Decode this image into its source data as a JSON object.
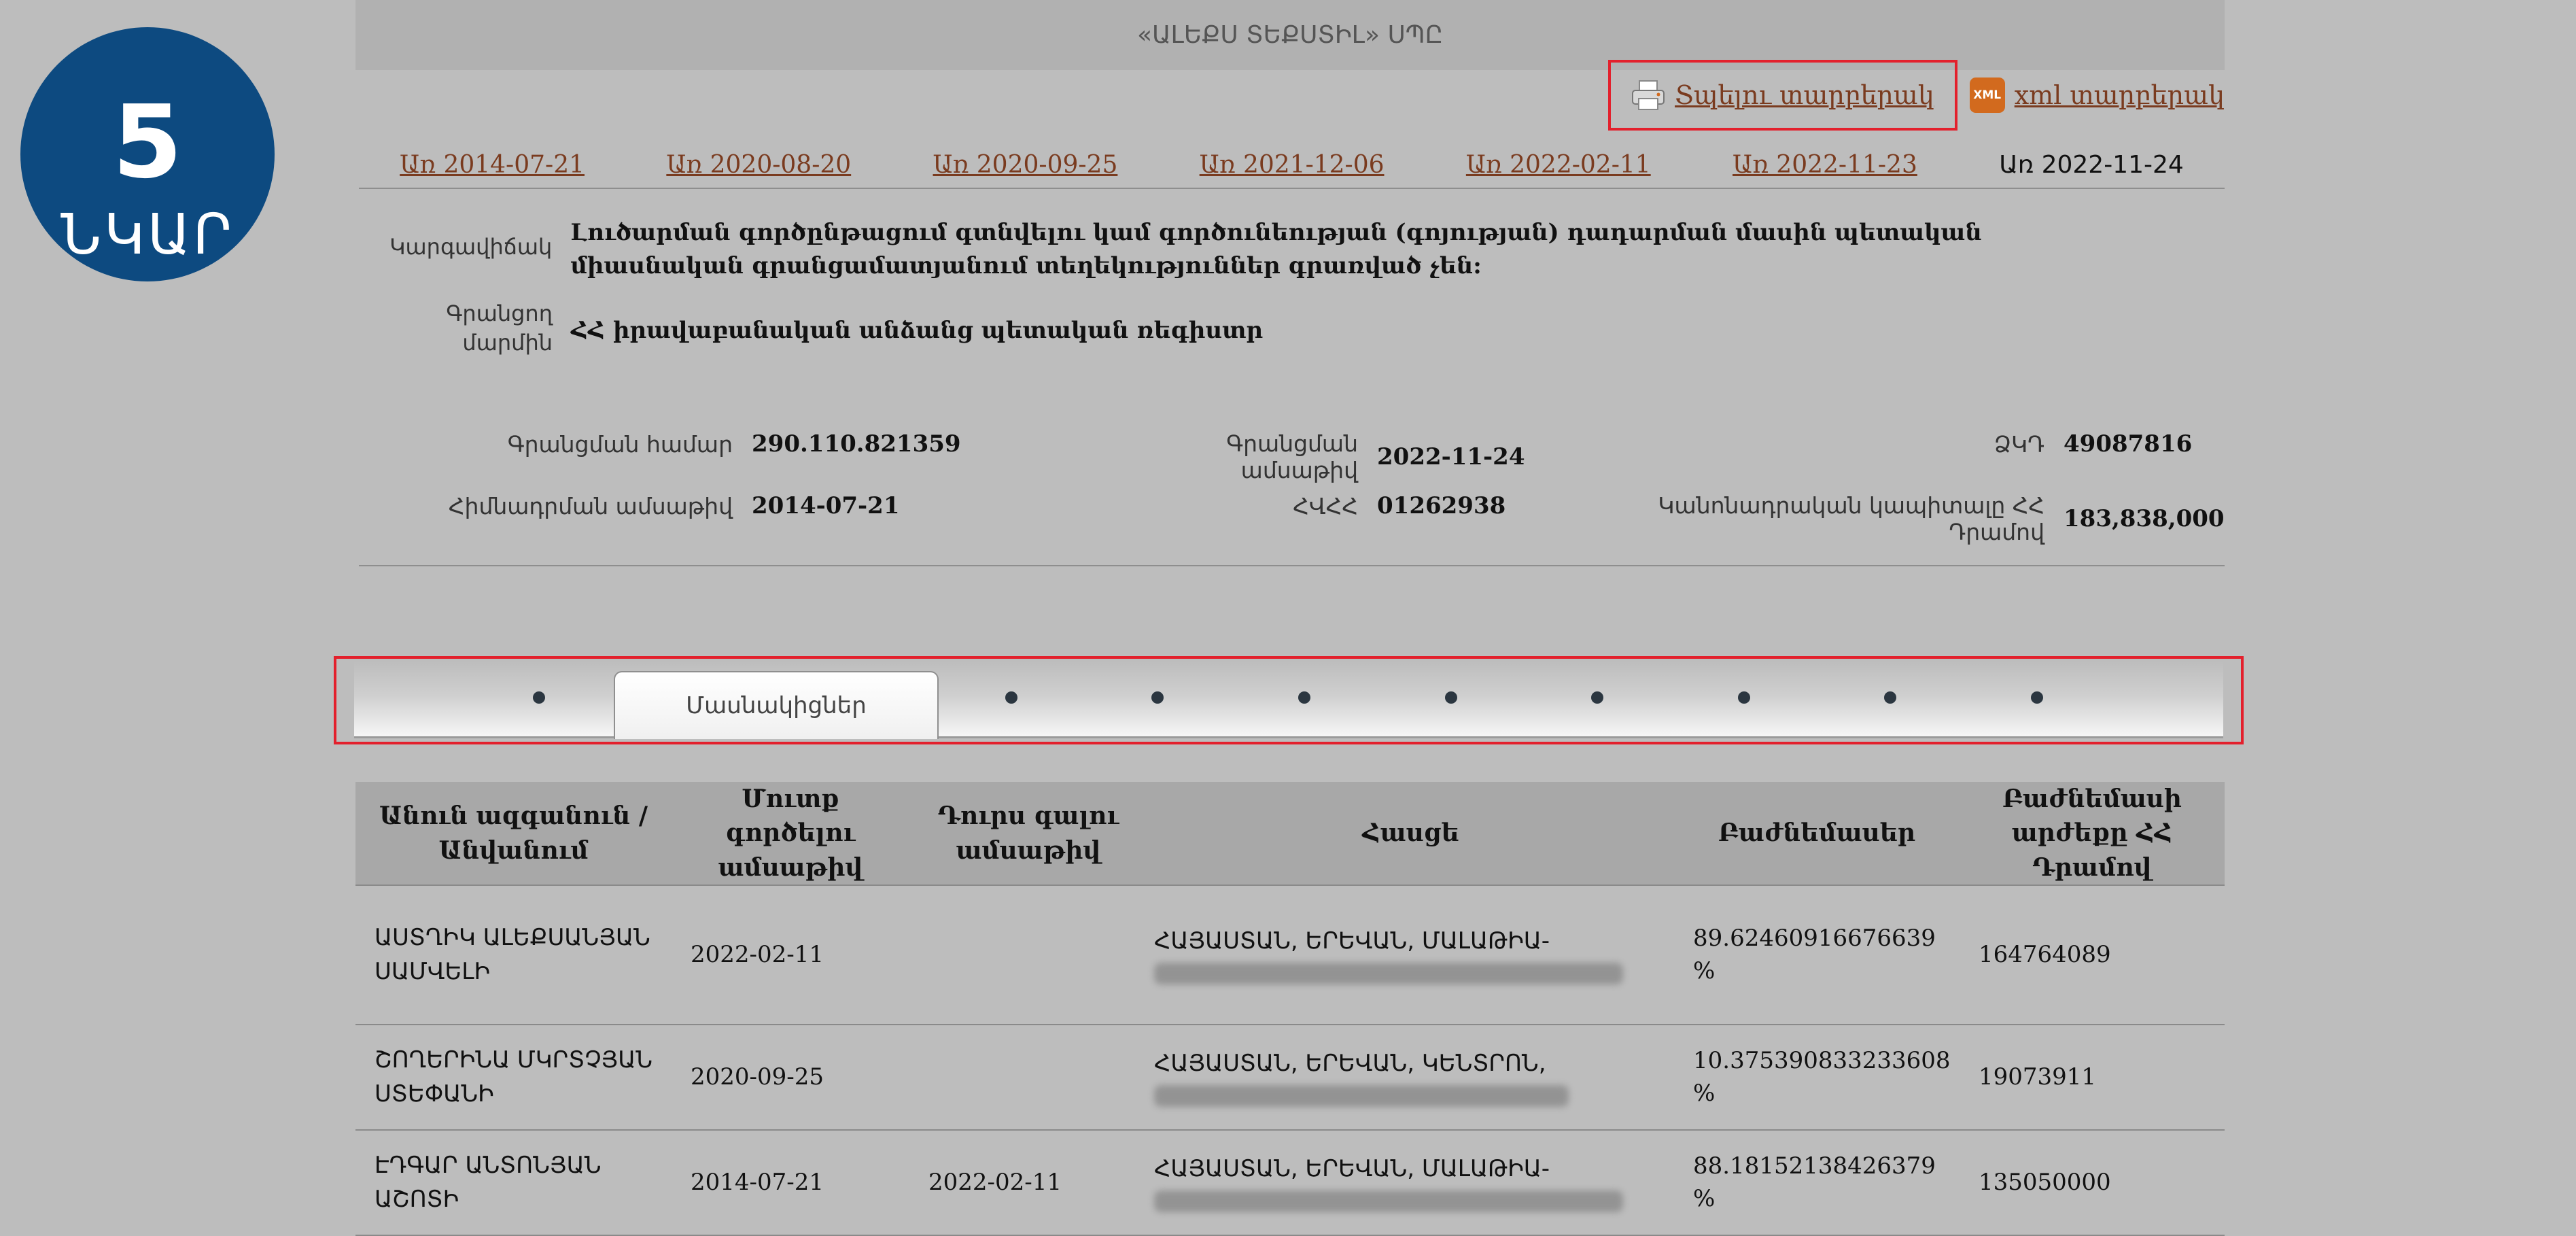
{
  "badge": {
    "number": "5",
    "label": "ՆԿԱՐ"
  },
  "header": {
    "company_title": "«ԱԼԵՔՍ ՏԵՔՍՏԻԼ» ՍՊԸ"
  },
  "actions": {
    "print_label": "Տպելու տարբերակ",
    "xml_label": "xml տարբերակ",
    "xml_icon_text": "XML"
  },
  "date_links": [
    "Առ 2014-07-21",
    "Առ 2020-08-20",
    "Առ 2020-09-25",
    "Առ 2021-12-06",
    "Առ 2022-02-11",
    "Առ 2022-11-23"
  ],
  "current_date": "Առ 2022-11-24",
  "status": {
    "label": "Կարգավիճակ",
    "value": "Լուծարման գործընթացում գտնվելու կամ գործունեության (գոյության) դադարման մասին պետական միասնական գրանցամատյանում տեղեկություններ գրառված չեն:"
  },
  "registrar": {
    "label": "Գրանցող մարմին",
    "value": "ՀՀ իրավաբանական անձանց պետական ռեգիստր"
  },
  "details": {
    "reg_number_label": "Գրանցման համար",
    "reg_number": "290.110.821359",
    "reg_date_label": "Գրանցման ամսաթիվ",
    "reg_date": "2022-11-24",
    "zkd_label": "ՁԿԴ",
    "zkd": "49087816",
    "founding_date_label": "Հիմնադրման ամսաթիվ",
    "founding_date": "2014-07-21",
    "tin_label": "ՀՎՀՀ",
    "tin": "01262938",
    "capital_label": "Կանոնադրական կապիտալը ՀՀ Դրամով",
    "capital": "183,838,000"
  },
  "tabs": {
    "active_label": "Մասնակիցներ",
    "dot_count": 9
  },
  "table": {
    "headers": [
      "Անուն ազգանուն / Անվանում",
      "Մուտք գործելու ամսաթիվ",
      "Դուրս գալու ամսաթիվ",
      "Հասցե",
      "Բաժնեմասեր",
      "Բաժնեմասի արժեքը ՀՀ Դրամով"
    ],
    "rows": [
      {
        "name": "ԱՍՏՂԻԿ ԱԼԵՔՍԱՆՅԱՆ ՍԱՄՎԵԼԻ",
        "entry": "2022-02-11",
        "exit": "",
        "address": "ՀԱՅԱՍՏԱՆ, ԵՐԵՎԱՆ, ՄԱԼԱԹԻԱ-",
        "share": "89.62460916676639 %",
        "value": "164764089"
      },
      {
        "name": "ՇՈՂԵՐԻՆԱ ՄԿՐՏՉՅԱՆ ՍՏԵՓԱՆԻ",
        "entry": "2020-09-25",
        "exit": "",
        "address": "ՀԱՅԱՍՏԱՆ, ԵՐԵՎԱՆ, ԿԵՆՏՐՈՆ,",
        "share": "10.375390833233608 %",
        "value": "19073911"
      },
      {
        "name": "ԷԴԳԱՐ ԱՆՏՈՆՅԱՆ ԱՇՈՏԻ",
        "entry": "2014-07-21",
        "exit": "2022-02-11",
        "address": "ՀԱՅԱՍՏԱՆ, ԵՐԵՎԱՆ, ՄԱԼԱԹԻԱ-",
        "share": "88.18152138426379 %",
        "value": "135050000"
      }
    ]
  }
}
